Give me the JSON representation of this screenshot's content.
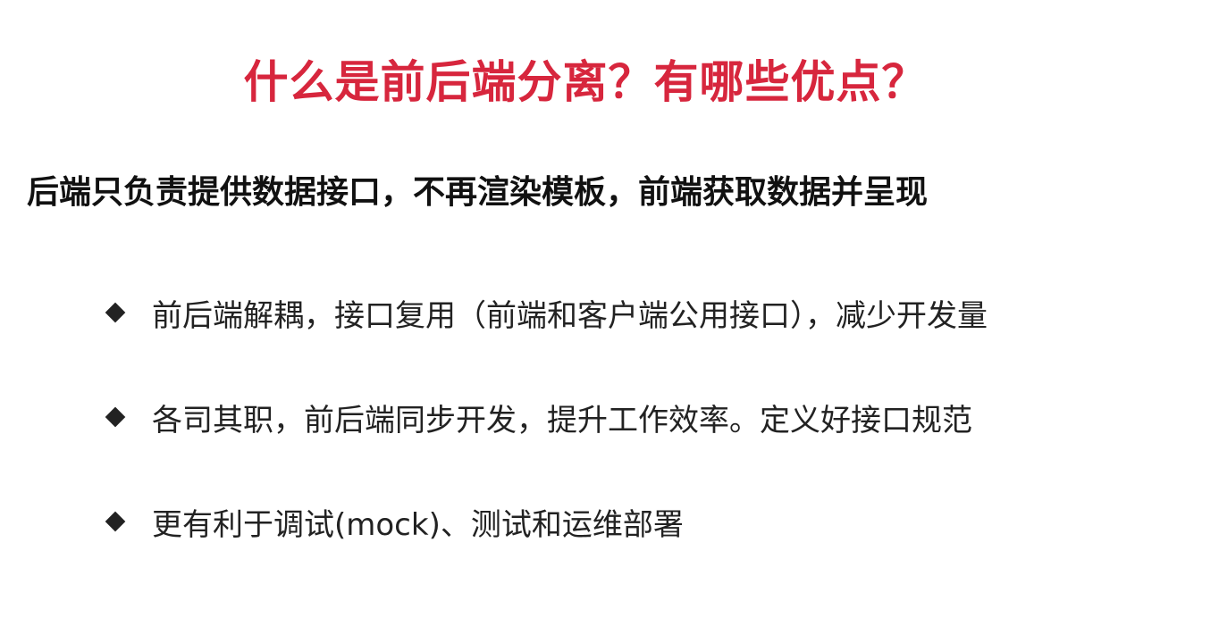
{
  "slide": {
    "title": "什么是前后端分离？有哪些优点？",
    "subtitle": "后端只负责提供数据接口，不再渲染模板，前端获取数据并呈现",
    "bullets": [
      {
        "icon": "diamond-bullet-icon",
        "text": "前后端解耦，接口复用（前端和客户端公用接口），减少开发量"
      },
      {
        "icon": "diamond-bullet-icon",
        "text": "各司其职，前后端同步开发，提升工作效率。定义好接口规范"
      },
      {
        "icon": "diamond-bullet-icon",
        "text": "更有利于调试(mock)、测试和运维部署"
      }
    ],
    "colors": {
      "title": "#d7263d",
      "text": "#222222",
      "background": "#ffffff"
    }
  }
}
